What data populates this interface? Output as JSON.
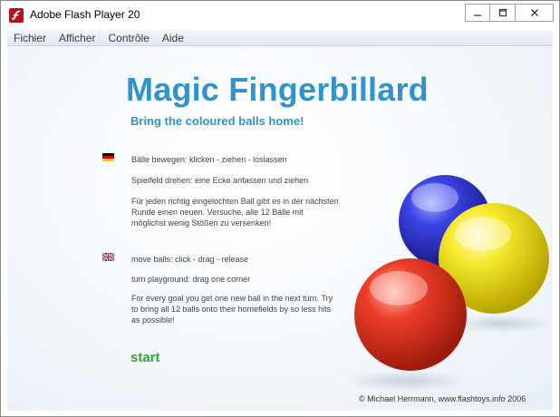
{
  "window": {
    "title": "Adobe Flash Player 20",
    "icon": "flash-player-icon"
  },
  "menu": {
    "items": [
      {
        "label": "Fichier"
      },
      {
        "label": "Afficher"
      },
      {
        "label": "Contrôle"
      },
      {
        "label": "Aide"
      }
    ]
  },
  "game": {
    "title": "Magic Fingerbillard",
    "subtitle": "Bring the coloured balls home!",
    "german": {
      "line1": "Bälle bewegen: klicken - ziehen - loslassen",
      "line2": "Spielfeld drehen: eine Ecke anfassen und ziehen",
      "line3": "Für jeden richtig eingelochten Ball gibt es in der nächsten Runde einen neuen. Versuche, alle 12 Bälle mit möglichst wenig Stößen zu versenken!"
    },
    "english": {
      "line1": "move balls: click - drag - release",
      "line2": "turn playground: drag one corner",
      "line3": "For every goal you get one new ball in the next turn. Try to bring all 12 balls onto their homefields by so less hits as possible!"
    },
    "start_label": "start",
    "copyright": "© Michael Herrmann, www.flashtoys.info 2006"
  },
  "colors": {
    "title": "#3193cc",
    "start": "#3aa13a",
    "ball_blue": "#2a2fd0",
    "ball_yellow": "#f2e21e",
    "ball_red": "#e53322"
  }
}
